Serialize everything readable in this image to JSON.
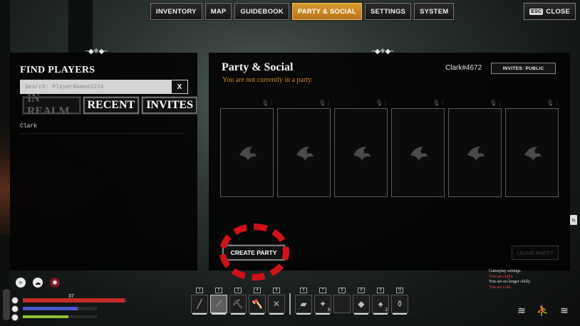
{
  "nav": {
    "tabs": [
      {
        "label": "INVENTORY"
      },
      {
        "label": "MAP"
      },
      {
        "label": "GUIDEBOOK"
      },
      {
        "label": "PARTY & SOCIAL"
      },
      {
        "label": "SETTINGS"
      },
      {
        "label": "SYSTEM"
      }
    ],
    "active_tab": "PARTY & SOCIAL",
    "esc_key": "ESC",
    "close_label": "CLOSE"
  },
  "find_players": {
    "title": "FIND PLAYERS",
    "search_placeholder": "Search: PlayerName#1234",
    "search_value": "",
    "clear_label": "X",
    "filters": [
      {
        "label": "IN REALM",
        "dimmed": true
      },
      {
        "label": "RECENT",
        "dimmed": false
      },
      {
        "label": "INVITES",
        "dimmed": false
      }
    ],
    "players": [
      "Clark"
    ]
  },
  "party": {
    "title": "Party & Social",
    "status": "You are not currently in a party.",
    "user_tag": "Clark#4672",
    "invites_label": "INVITES: PUBLIC",
    "slot_count": 6,
    "create_label": "CREATE PARTY",
    "leave_label": "LEAVE PARTY"
  },
  "hud": {
    "health_value": "37",
    "health_fraction": 0.98,
    "stamina_fraction": 0.74,
    "food_fraction": 0.62,
    "colors": {
      "health": "#c42a2a",
      "stamina": "#4a57c8",
      "food": "#8fbf3a"
    },
    "status_icons": [
      "wind-icon",
      "cloud-icon",
      "cold-snowflake-icon"
    ],
    "hotbar": [
      {
        "key": "1",
        "icon": "knife-icon",
        "count": ""
      },
      {
        "key": "2",
        "icon": "sword-icon",
        "count": "",
        "selected": true
      },
      {
        "key": "3",
        "icon": "pickaxe-icon",
        "count": ""
      },
      {
        "key": "4",
        "icon": "axe-icon",
        "count": ""
      },
      {
        "key": "5",
        "icon": "crossbow-icon",
        "count": ""
      },
      {
        "key": "6",
        "icon": "wood-log-icon",
        "count": ""
      },
      {
        "key": "7",
        "icon": "torch-icon",
        "count": "3"
      },
      {
        "key": "8",
        "icon": "empty-slot-icon",
        "count": ""
      },
      {
        "key": "9",
        "icon": "meat-icon",
        "count": ""
      },
      {
        "key": "0",
        "icon": "mushroom-icon",
        "count": "2"
      },
      {
        "key": "Q",
        "icon": "flask-icon",
        "count": ""
      }
    ],
    "log": [
      "Gameplay settings.",
      "You are chilly.",
      "You are no longer chilly.",
      "You are cold."
    ]
  }
}
